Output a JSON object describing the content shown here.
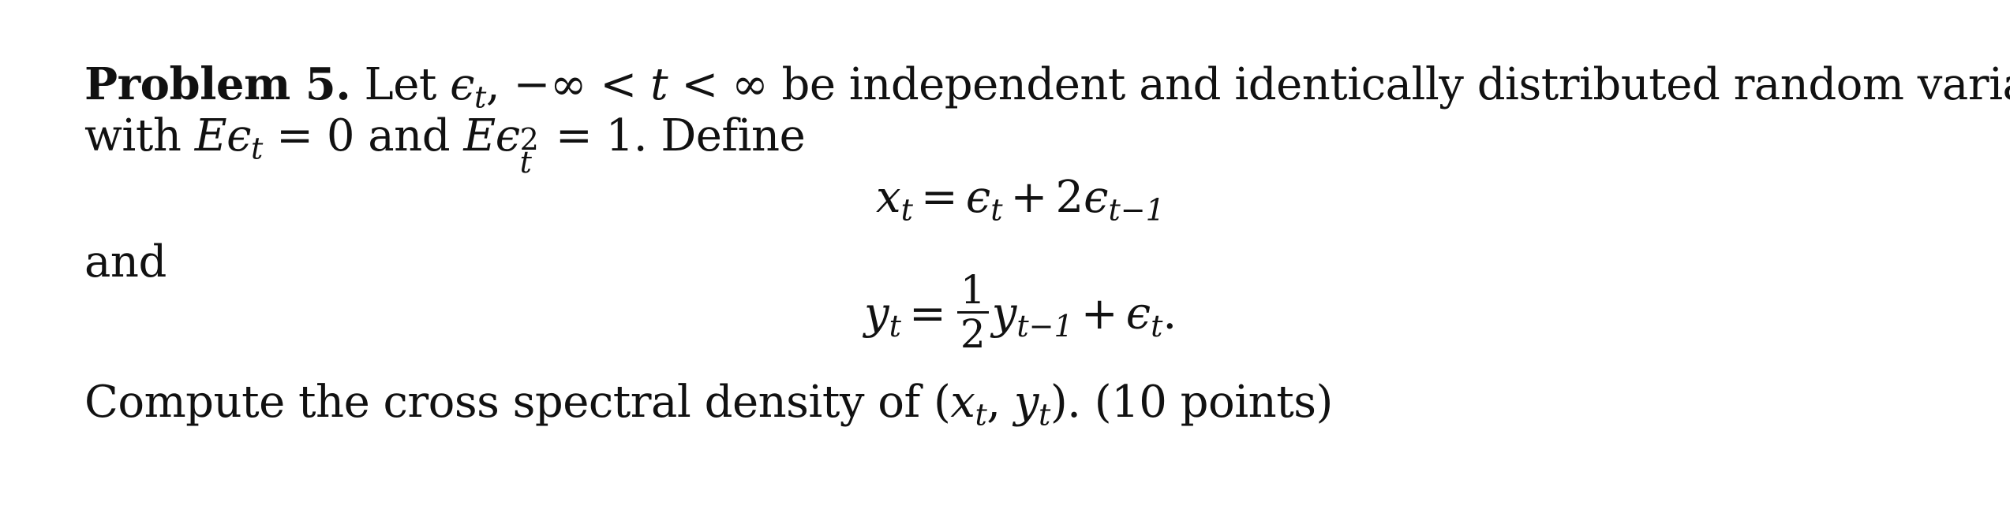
{
  "problem": {
    "label": "Problem 5.",
    "line1": {
      "text_a": " Let ",
      "eps": "ϵ",
      "sub_t": "t",
      "text_b": ", −∞ < ",
      "t": "t",
      "text_c": " < ∞ be independent and identically distributed random variables"
    },
    "line2": {
      "text_a": "with ",
      "E": "E",
      "eps": "ϵ",
      "sub_t": "t",
      "text_b": " = 0 and ",
      "E2": "E",
      "eps2": "ϵ",
      "sup2": "2",
      "sub2": "t",
      "text_c": " = 1. Define"
    },
    "equation1": {
      "lhs": "x",
      "lhs_sub": "t",
      "eq": "=",
      "term1": "ϵ",
      "term1_sub": "t",
      "plus": "+",
      "coef": "2",
      "term2": "ϵ",
      "term2_sub": "t−1"
    },
    "connector": "and",
    "equation2": {
      "lhs": "y",
      "lhs_sub": "t",
      "eq": "=",
      "frac_num": "1",
      "frac_den": "2",
      "term1": "y",
      "term1_sub": "t−1",
      "plus": "+",
      "term2": "ϵ",
      "term2_sub": "t",
      "period": "."
    },
    "question": {
      "text_a": "Compute the cross spectral density of (",
      "x": "x",
      "x_sub": "t",
      "comma": ", ",
      "y": "y",
      "y_sub": "t",
      "text_b": "). (10 points)"
    }
  }
}
